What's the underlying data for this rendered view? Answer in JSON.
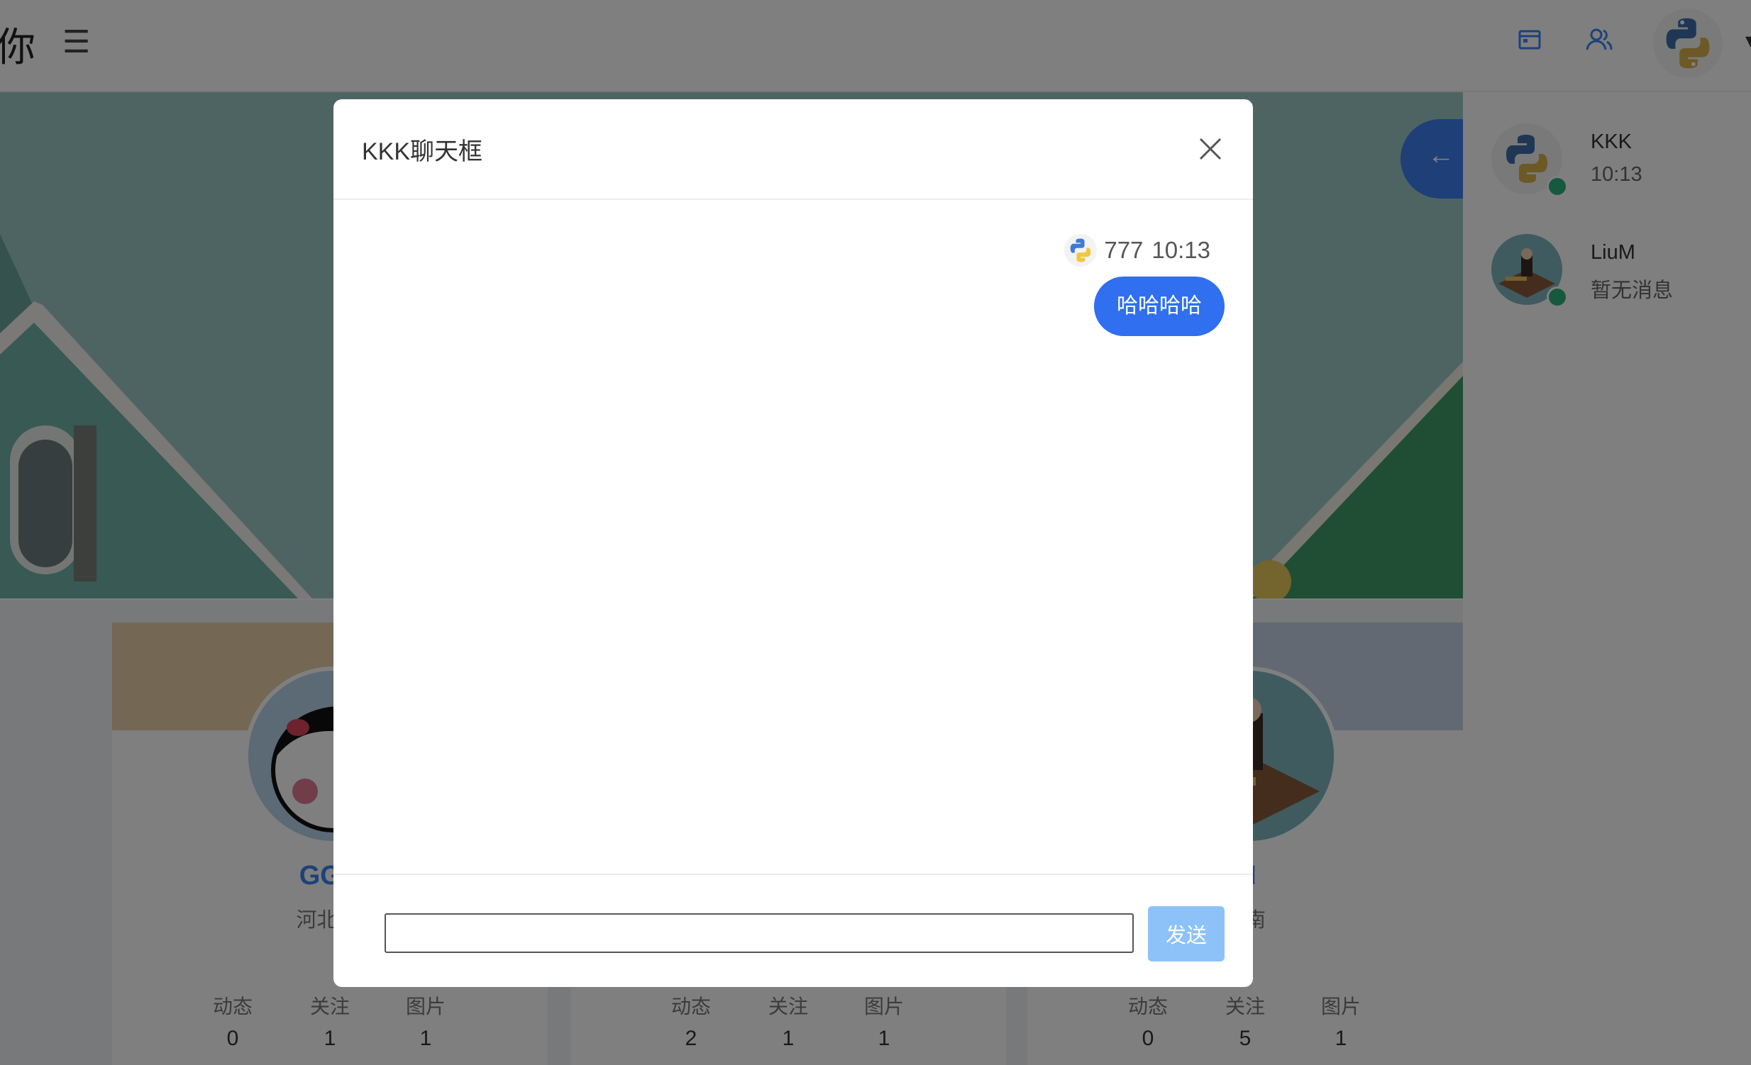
{
  "header": {
    "brand": "你",
    "menu_icon": "menu-icon",
    "icons": [
      "window-icon",
      "users-icon"
    ],
    "caret": "▾"
  },
  "back_icon": "←",
  "contacts": [
    {
      "name": "KKK",
      "message": "10:13",
      "online": true
    },
    {
      "name": "LiuM",
      "message": "暂无消息",
      "online": true
    }
  ],
  "cards": [
    {
      "name": "GGB",
      "location": "河北 石",
      "stats": [
        {
          "label": "动态",
          "value": "0"
        },
        {
          "label": "关注",
          "value": "1"
        },
        {
          "label": "图片",
          "value": "1"
        }
      ]
    },
    {
      "name": "",
      "location": "",
      "stats": [
        {
          "label": "动态",
          "value": "2"
        },
        {
          "label": "关注",
          "value": "1"
        },
        {
          "label": "图片",
          "value": "1"
        }
      ]
    },
    {
      "name": "M",
      "location": "济南",
      "stats": [
        {
          "label": "动态",
          "value": "0"
        },
        {
          "label": "关注",
          "value": "5"
        },
        {
          "label": "图片",
          "value": "1"
        }
      ]
    }
  ],
  "chat": {
    "title": "KKK聊天框",
    "close_icon": "close-icon",
    "messages": [
      {
        "sender": "777",
        "time": "10:13",
        "text": "哈哈哈哈"
      }
    ],
    "input_value": "",
    "send_label": "发送"
  },
  "colors": {
    "accent": "#2f6ff0",
    "send_button": "#8cc2f8",
    "online": "#2fb37c",
    "overlay": "rgba(0,0,0,0.5)"
  }
}
